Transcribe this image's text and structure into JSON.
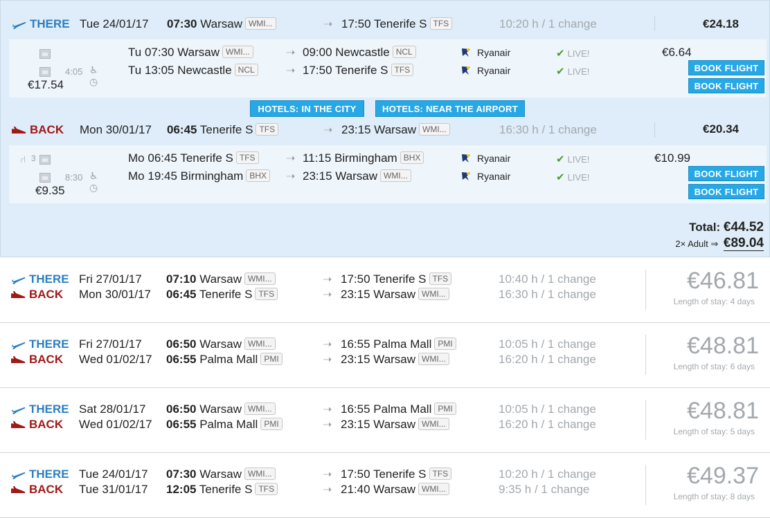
{
  "expanded": {
    "there": {
      "label": "THERE",
      "date": "Tue 24/01/17",
      "dep_time": "07:30",
      "dep_city": "Warsaw",
      "dep_code": "WMI...",
      "arr_time": "17:50",
      "arr_city": "Tenerife S",
      "arr_code": "TFS",
      "duration": "10:20 h / 1 change",
      "price": "€24.18",
      "legs_price": "€17.54",
      "layover": "4:05",
      "legs": [
        {
          "day": "Tu",
          "dep_time": "07:30",
          "dep_city": "Warsaw",
          "dep_code": "WMI...",
          "arr_time": "09:00",
          "arr_city": "Newcastle",
          "arr_code": "NCL",
          "airline": "Ryanair",
          "status": "LIVE!",
          "price": "€6.64",
          "book": "BOOK FLIGHT"
        },
        {
          "day": "Tu",
          "dep_time": "13:05",
          "dep_city": "Newcastle",
          "dep_code": "NCL",
          "arr_time": "17:50",
          "arr_city": "Tenerife S",
          "arr_code": "TFS",
          "airline": "Ryanair",
          "status": "LIVE!",
          "price": "",
          "book": "BOOK FLIGHT"
        }
      ]
    },
    "hotels": {
      "city": "HOTELS: IN THE CITY",
      "airport": "HOTELS: NEAR THE AIRPORT"
    },
    "back": {
      "label": "BACK",
      "date": "Mon 30/01/17",
      "dep_time": "06:45",
      "dep_city": "Tenerife S",
      "dep_code": "TFS",
      "arr_time": "23:15",
      "arr_city": "Warsaw",
      "arr_code": "WMI...",
      "duration": "16:30 h / 1 change",
      "price": "€20.34",
      "legs_price": "€9.35",
      "layover": "8:30",
      "seats": "3",
      "legs": [
        {
          "day": "Mo",
          "dep_time": "06:45",
          "dep_city": "Tenerife S",
          "dep_code": "TFS",
          "arr_time": "11:15",
          "arr_city": "Birmingham",
          "arr_code": "BHX",
          "airline": "Ryanair",
          "status": "LIVE!",
          "price": "€10.99",
          "book": "BOOK FLIGHT"
        },
        {
          "day": "Mo",
          "dep_time": "19:45",
          "dep_city": "Birmingham",
          "dep_code": "BHX",
          "arr_time": "23:15",
          "arr_city": "Warsaw",
          "arr_code": "WMI...",
          "airline": "Ryanair",
          "status": "LIVE!",
          "price": "",
          "book": "BOOK FLIGHT"
        }
      ]
    },
    "total_label": "Total:",
    "total": "€44.52",
    "adult_label": "2× Adult ⇒",
    "adult_total": "€89.04"
  },
  "results": [
    {
      "price": "€46.81",
      "stay": "Length of stay: 4 days",
      "there": {
        "label": "THERE",
        "date": "Fri 27/01/17",
        "dep_time": "07:10",
        "dep_city": "Warsaw",
        "dep_code": "WMI...",
        "arr_time": "17:50",
        "arr_city": "Tenerife S",
        "arr_code": "TFS",
        "duration": "10:40 h / 1 change"
      },
      "back": {
        "label": "BACK",
        "date": "Mon 30/01/17",
        "dep_time": "06:45",
        "dep_city": "Tenerife S",
        "dep_code": "TFS",
        "arr_time": "23:15",
        "arr_city": "Warsaw",
        "arr_code": "WMI...",
        "duration": "16:30 h / 1 change"
      }
    },
    {
      "price": "€48.81",
      "stay": "Length of stay: 6 days",
      "there": {
        "label": "THERE",
        "date": "Fri 27/01/17",
        "dep_time": "06:50",
        "dep_city": "Warsaw",
        "dep_code": "WMI...",
        "arr_time": "16:55",
        "arr_city": "Palma Mall",
        "arr_code": "PMI",
        "duration": "10:05 h / 1 change"
      },
      "back": {
        "label": "BACK",
        "date": "Wed 01/02/17",
        "dep_time": "06:55",
        "dep_city": "Palma Mall",
        "dep_code": "PMI",
        "arr_time": "23:15",
        "arr_city": "Warsaw",
        "arr_code": "WMI...",
        "duration": "16:20 h / 1 change"
      }
    },
    {
      "price": "€48.81",
      "stay": "Length of stay: 5 days",
      "there": {
        "label": "THERE",
        "date": "Sat 28/01/17",
        "dep_time": "06:50",
        "dep_city": "Warsaw",
        "dep_code": "WMI...",
        "arr_time": "16:55",
        "arr_city": "Palma Mall",
        "arr_code": "PMI",
        "duration": "10:05 h / 1 change"
      },
      "back": {
        "label": "BACK",
        "date": "Wed 01/02/17",
        "dep_time": "06:55",
        "dep_city": "Palma Mall",
        "dep_code": "PMI",
        "arr_time": "23:15",
        "arr_city": "Warsaw",
        "arr_code": "WMI...",
        "duration": "16:20 h / 1 change"
      }
    },
    {
      "price": "€49.37",
      "stay": "Length of stay: 8 days",
      "there": {
        "label": "THERE",
        "date": "Tue 24/01/17",
        "dep_time": "07:30",
        "dep_city": "Warsaw",
        "dep_code": "WMI...",
        "arr_time": "17:50",
        "arr_city": "Tenerife S",
        "arr_code": "TFS",
        "duration": "10:20 h / 1 change"
      },
      "back": {
        "label": "BACK",
        "date": "Tue 31/01/17",
        "dep_time": "12:05",
        "dep_city": "Tenerife S",
        "dep_code": "TFS",
        "arr_time": "21:40",
        "arr_city": "Warsaw",
        "arr_code": "WMI...",
        "duration": "9:35 h / 1 change"
      }
    }
  ],
  "colors": {
    "there": "#2b7fc0",
    "back": "#a01818",
    "button": "#27a8e6",
    "panel": "#deedf9"
  },
  "icons": {
    "there": "plane-takeoff-icon",
    "back": "plane-landing-icon",
    "photo": "photo-icon",
    "layover": "layover-clock-icon",
    "airline": "ryanair-logo-icon",
    "check": "check-icon",
    "arrow": "arrow-right-icon",
    "seat": "seat-icon"
  }
}
